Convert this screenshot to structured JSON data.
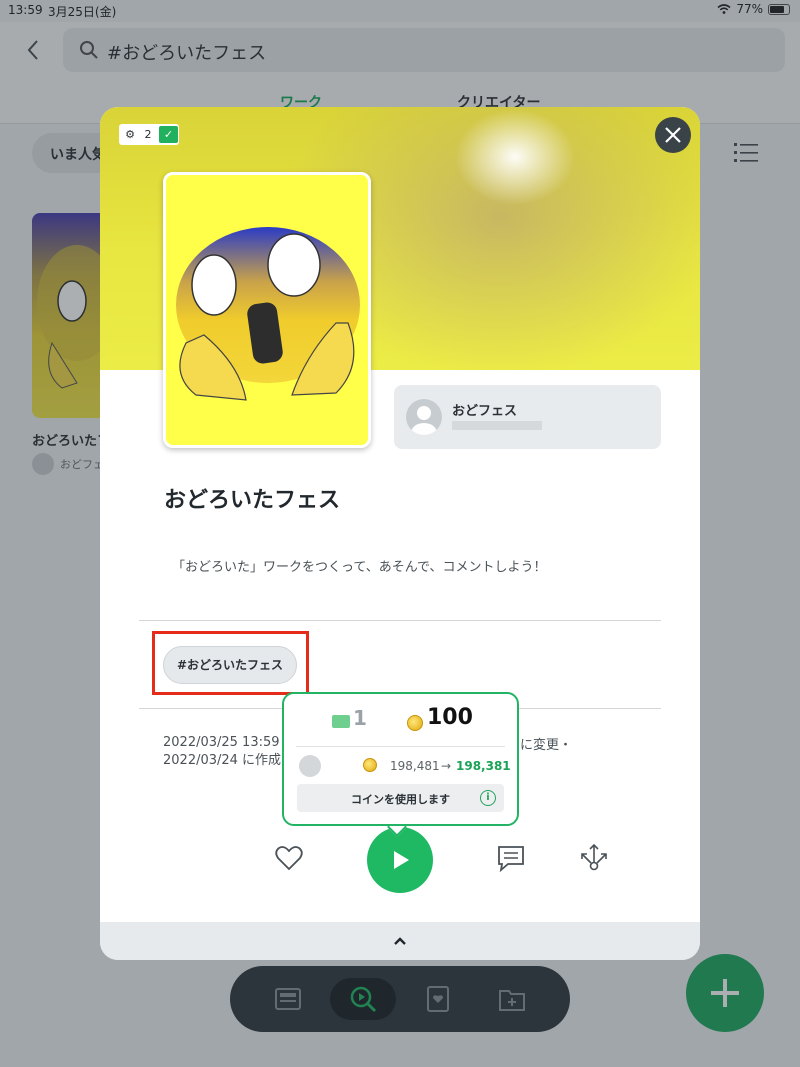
{
  "status_bar": {
    "time": "13:59",
    "date": "3月25日(金)",
    "battery": "77%"
  },
  "header": {
    "search_value": "#おどろいたフェス",
    "tabs": [
      {
        "label": "ワーク",
        "active": true
      },
      {
        "label": "クリエイター",
        "active": false
      }
    ]
  },
  "filter": {
    "label": "いま人気"
  },
  "background_card": {
    "title": "おどろいたフェス",
    "author": "おどフェス"
  },
  "modal": {
    "counter": "2",
    "title": "おどろいたフェス",
    "author_name": "おどフェス",
    "description": "「おどろいた」ワークをつくって、あそんで、コメントしよう！",
    "tag": "#おどろいたフェス",
    "dates": {
      "line1": "2022/03/25 13:59",
      "line1_tail": "に変更・",
      "line2": "2022/03/24 に作成"
    }
  },
  "coin_popup": {
    "ticket_count": "1",
    "coin_count": "100",
    "balance_before": "198,481",
    "arrow": "→",
    "balance_after": "198,381",
    "use_label": "コインを使用します",
    "info": "i"
  },
  "colors": {
    "accent_green": "#1fb964",
    "highlight_red": "#e52b19",
    "banner_yellow": "#e8e640"
  },
  "icons": {
    "back": "chevron-left-icon",
    "search": "search-icon",
    "list_view": "list-icon",
    "close": "close-icon",
    "like": "heart-icon",
    "play": "play-icon",
    "comment": "comment-icon",
    "share": "share-icon",
    "expand": "chevron-up-icon",
    "add": "plus-icon"
  }
}
